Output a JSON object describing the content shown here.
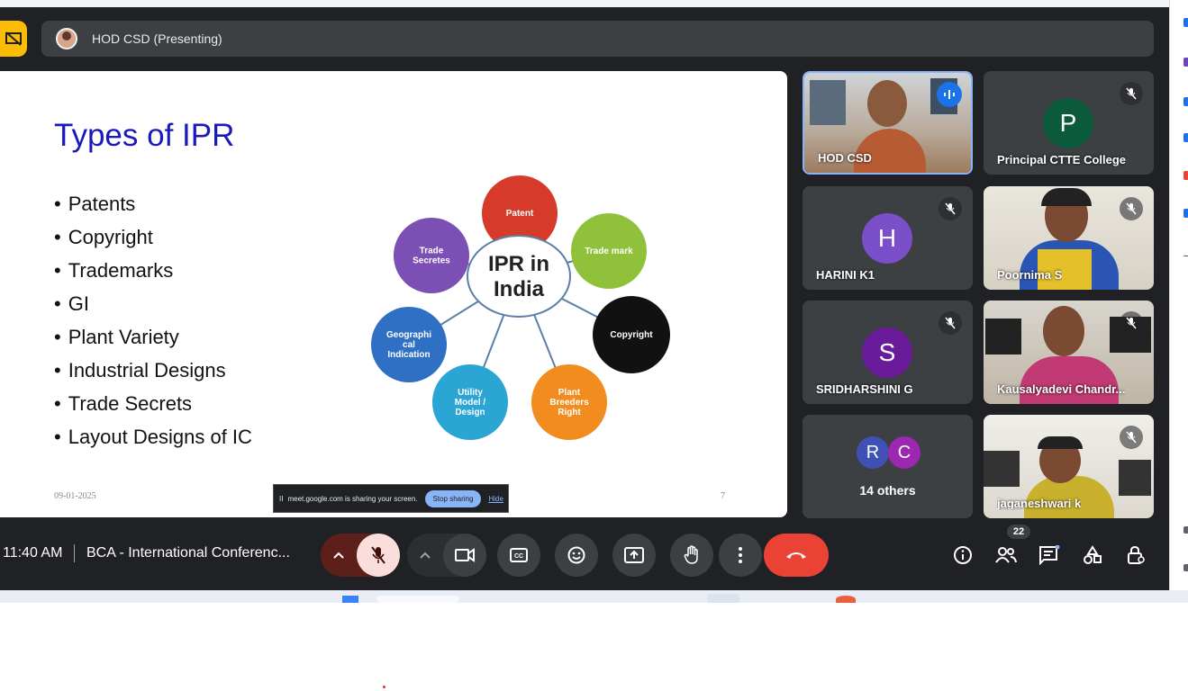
{
  "presenting_bar": {
    "title": "HOD CSD (Presenting)"
  },
  "slide": {
    "title": "Types of IPR",
    "bullets": [
      "Patents",
      "Copyright",
      "Trademarks",
      "GI",
      "Plant Variety",
      "Industrial Designs",
      "Trade Secrets",
      "Layout Designs of IC"
    ],
    "date": "09-01-2025",
    "page_number": "7",
    "diagram": {
      "center": [
        "IPR in",
        "India"
      ],
      "nodes": [
        {
          "lines": [
            "Patent"
          ],
          "color": "#d63a2a"
        },
        {
          "lines": [
            "Trade mark"
          ],
          "color": "#8fc23a"
        },
        {
          "lines": [
            "Copyright"
          ],
          "color": "#111111"
        },
        {
          "lines": [
            "Plant",
            "Breeders",
            "Right"
          ],
          "color": "#f28c1e"
        },
        {
          "lines": [
            "Utility",
            "Model /",
            "Design"
          ],
          "color": "#2ba6d4"
        },
        {
          "lines": [
            "Geographi",
            "cal",
            "Indication"
          ],
          "color": "#2f6fc4"
        },
        {
          "lines": [
            "Trade",
            "Secretes"
          ],
          "color": "#7b4fb3"
        }
      ]
    }
  },
  "share_bar": {
    "message": "meet.google.com is sharing your screen.",
    "stop_label": "Stop sharing",
    "hide_label": "Hide",
    "pause_glyph": "II"
  },
  "participants": {
    "hod": {
      "name": "HOD CSD"
    },
    "principal": {
      "name": "Principal CTTE College",
      "initial": "P",
      "color": "#0b5a3c"
    },
    "harini": {
      "name": "HARINI K1",
      "initial": "H",
      "color": "#7b4fc9"
    },
    "poornima": {
      "name": "Poornima S"
    },
    "sridharshini": {
      "name": "SRIDHARSHINI G",
      "initial": "S",
      "color": "#6a1b9a"
    },
    "kausalyadevi": {
      "name": "Kausalyadevi Chandr..."
    },
    "others": {
      "label": "14 others",
      "initials": [
        "R",
        "C"
      ],
      "colors": [
        "#3f51b5",
        "#9c27b0"
      ]
    },
    "jaganeshwari": {
      "name": "jaganeshwari k"
    }
  },
  "bottom_bar": {
    "time": "11:40 AM",
    "meeting_name": "BCA - International Conferenc...",
    "people_count": "22",
    "leave_color": "#ea4335",
    "mic_off_color": "#f9dedc"
  }
}
